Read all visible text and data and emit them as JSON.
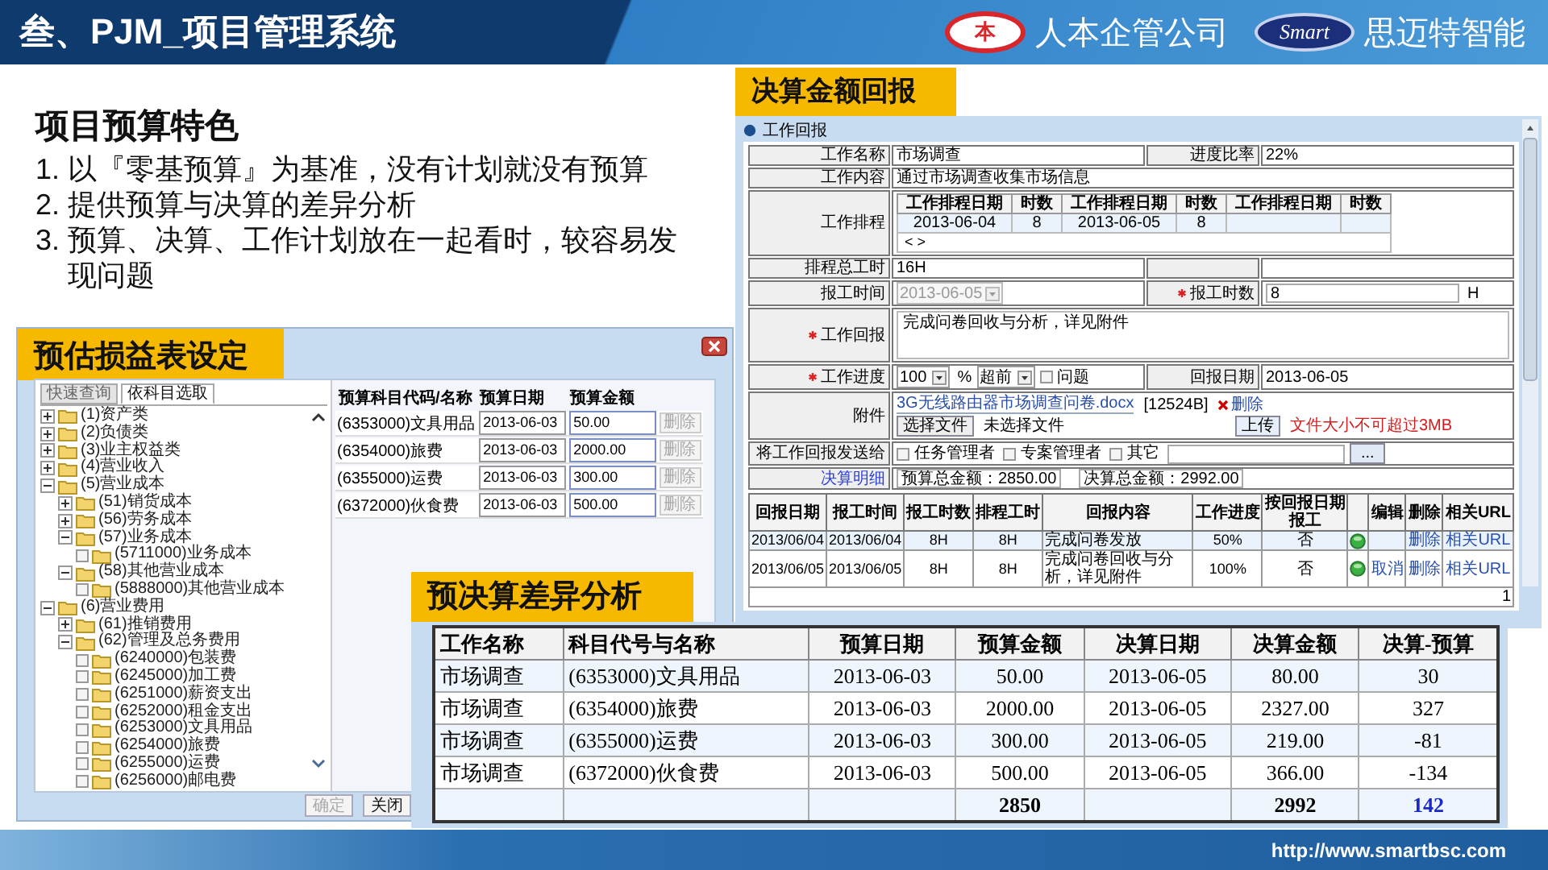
{
  "slide": {
    "title": "叁、PJM_项目管理系统",
    "logos": [
      {
        "mark": "本",
        "name": "人本企管公司"
      },
      {
        "mark": "Smart",
        "name": "思迈特智能"
      }
    ],
    "url": "http://www.smartbsc.com"
  },
  "features": {
    "heading": "项目预算特色",
    "items": [
      {
        "number": "1.",
        "text": "以『零基预算』为基准，没有计划就没有预算"
      },
      {
        "number": "2.",
        "text": "提供预算与决算的差异分析"
      },
      {
        "number": "3.",
        "text": "预算、决算、工作计划放在一起看时，较容易发现问题"
      }
    ]
  },
  "report_window": {
    "caption": "决算金额回报",
    "title": "工作回报",
    "work_name": {
      "label": "工作名称",
      "value": "市场调查"
    },
    "progress_rate": {
      "label": "进度比率",
      "value": "22%"
    },
    "work_content": {
      "label": "工作内容",
      "value": "通过市场调查收集市场信息"
    },
    "schedule": {
      "label": "工作排程",
      "columns": [
        "工作排程日期",
        "时数",
        "工作排程日期",
        "时数",
        "工作排程日期",
        "时数"
      ],
      "cells": [
        "2013-06-04",
        "8",
        "2013-06-05",
        "8"
      ],
      "pager": "< >"
    },
    "total_hours": {
      "label": "排程总工时",
      "value": "16H"
    },
    "report_time": {
      "label": "报工时间",
      "value": "2013-06-05",
      "disabled": true
    },
    "report_hours": {
      "label": "报工时数",
      "required": true,
      "value": "8",
      "unit": "H"
    },
    "report": {
      "label": "工作回报",
      "required": true,
      "value": "完成问卷回收与分析，详见附件"
    },
    "progress": {
      "label": "工作进度",
      "required": true,
      "value": "100",
      "unit": "%",
      "timing": "超前",
      "issue": {
        "label": "问题",
        "checked": false
      }
    },
    "report_date": {
      "label": "回报日期",
      "value": "2013-06-05"
    },
    "attachment": {
      "label": "附件",
      "file": "3G无线路由器市场调查问卷.docx",
      "size": "[12524B]",
      "remove": "删除",
      "choose": "选择文件",
      "status": "未选择文件",
      "upload": "上传",
      "limit": "文件大小不可超过3MB"
    },
    "send_to": {
      "label": "将工作回报发送给",
      "options": [
        {
          "label": "任务管理者",
          "checked": false
        },
        {
          "label": "专案管理者",
          "checked": false
        },
        {
          "label": "其它",
          "checked": false
        }
      ],
      "browse": "..."
    },
    "settlement": {
      "link": "决算明细",
      "budget_total": "预算总金额：2850.00",
      "actual_total": "决算总金额：2992.00"
    },
    "history": {
      "columns": [
        "回报日期",
        "报工时间",
        "报工时数",
        "排程工时",
        "回报内容",
        "工作进度",
        "按回报日期报工",
        "编辑",
        "删除",
        "相关URL"
      ],
      "rows": [
        {
          "report_date": "2013/06/04",
          "work_time": "2013/06/04",
          "hours": "8H",
          "scheduled": "8H",
          "content": "完成问卷发放",
          "progress": "50%",
          "by_date": "否",
          "delete": "删除",
          "url": "相关URL"
        },
        {
          "report_date": "2013/06/05",
          "work_time": "2013/06/05",
          "hours": "8H",
          "scheduled": "8H",
          "content": "完成问卷回收与分析，详见附件",
          "progress": "100%",
          "by_date": "否",
          "edit": "取消",
          "delete": "删除",
          "url": "相关URL"
        }
      ],
      "page": "1"
    }
  },
  "budget_window": {
    "caption": "预估损益表设定",
    "tabs": [
      {
        "label": "快速查询",
        "selected": false
      },
      {
        "label": "依科目选取",
        "selected": true
      }
    ],
    "tree": [
      {
        "kind": "folder",
        "label": "(1)资产类",
        "expanded": false
      },
      {
        "kind": "folder",
        "label": "(2)负债类",
        "expanded": false
      },
      {
        "kind": "folder",
        "label": "(3)业主权益类",
        "expanded": false
      },
      {
        "kind": "folder",
        "label": "(4)营业收入",
        "expanded": false
      },
      {
        "kind": "folder",
        "label": "(5)营业成本",
        "expanded": true,
        "children": [
          {
            "kind": "folder",
            "label": "(51)销货成本",
            "expanded": false
          },
          {
            "kind": "folder",
            "label": "(56)劳务成本",
            "expanded": false
          },
          {
            "kind": "folder",
            "label": "(57)业务成本",
            "expanded": true,
            "children": [
              {
                "kind": "account",
                "label": "(5711000)业务成本",
                "checked": false
              }
            ]
          },
          {
            "kind": "folder",
            "label": "(58)其他营业成本",
            "expanded": true,
            "children": [
              {
                "kind": "account",
                "label": "(5888000)其他营业成本",
                "checked": false
              }
            ]
          }
        ]
      },
      {
        "kind": "folder",
        "label": "(6)营业费用",
        "expanded": true,
        "children": [
          {
            "kind": "folder",
            "label": "(61)推销费用",
            "expanded": false
          },
          {
            "kind": "folder",
            "label": "(62)管理及总务费用",
            "expanded": true,
            "children": [
              {
                "kind": "account",
                "label": "(6240000)包装费",
                "checked": false
              },
              {
                "kind": "account",
                "label": "(6245000)加工费",
                "checked": false
              },
              {
                "kind": "account",
                "label": "(6251000)薪资支出",
                "checked": false
              },
              {
                "kind": "account",
                "label": "(6252000)租金支出",
                "checked": false
              },
              {
                "kind": "account",
                "label": "(6253000)文具用品",
                "checked": false
              },
              {
                "kind": "account",
                "label": "(6254000)旅费",
                "checked": false
              },
              {
                "kind": "account",
                "label": "(6255000)运费",
                "checked": false
              },
              {
                "kind": "account",
                "label": "(6256000)邮电费",
                "checked": false
              }
            ]
          }
        ]
      }
    ],
    "columns": [
      "预算科目代码/名称",
      "预算日期",
      "预算金额"
    ],
    "rows": [
      {
        "account": "(6353000)文具用品",
        "date": "2013-06-03",
        "amount": "50.00",
        "delete": "删除",
        "delete_disabled": true
      },
      {
        "account": "(6354000)旅费",
        "date": "2013-06-03",
        "amount": "2000.00",
        "delete": "删除",
        "delete_disabled": true
      },
      {
        "account": "(6355000)运费",
        "date": "2013-06-03",
        "amount": "300.00",
        "delete": "删除",
        "delete_disabled": true
      },
      {
        "account": "(6372000)伙食费",
        "date": "2013-06-03",
        "amount": "500.00",
        "delete": "删除",
        "delete_disabled": true
      }
    ],
    "buttons": [
      {
        "label": "确定",
        "disabled": true
      },
      {
        "label": "关闭",
        "disabled": false
      }
    ]
  },
  "variance": {
    "caption": "预决算差异分析",
    "columns": [
      "工作名称",
      "科目代号与名称",
      "预算日期",
      "预算金额",
      "决算日期",
      "决算金额",
      "决算-预算"
    ],
    "rows": [
      [
        "市场调查",
        "(6353000)文具用品",
        "2013-06-03",
        "50.00",
        "2013-06-05",
        "80.00",
        "30"
      ],
      [
        "市场调查",
        "(6354000)旅费",
        "2013-06-03",
        "2000.00",
        "2013-06-05",
        "2327.00",
        "327"
      ],
      [
        "市场调查",
        "(6355000)运费",
        "2013-06-03",
        "300.00",
        "2013-06-05",
        "219.00",
        "-81"
      ],
      [
        "市场调查",
        "(6372000)伙食费",
        "2013-06-03",
        "500.00",
        "2013-06-05",
        "366.00",
        "-134"
      ]
    ],
    "totals": {
      "budget": "2850",
      "actual": "2992",
      "difference": "142"
    }
  }
}
